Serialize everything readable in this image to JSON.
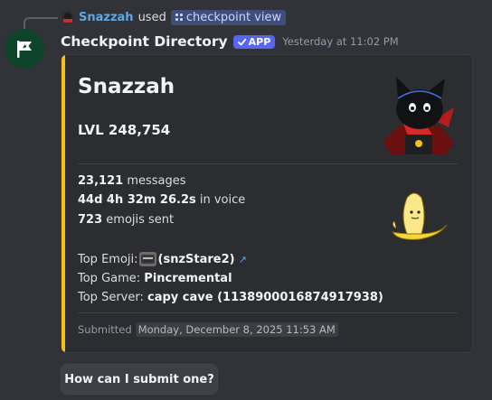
{
  "reply": {
    "username": "Snazzah",
    "verb": "used",
    "command": "checkpoint view"
  },
  "message": {
    "bot_name": "Checkpoint Directory",
    "badge": "APP",
    "timestamp": "Yesterday at 11:02 PM"
  },
  "embed": {
    "accent_color": "#f2c218",
    "title": "Snazzah",
    "level": "LVL 248,754",
    "messages": {
      "value": "23,121",
      "label": "messages"
    },
    "voice": {
      "value": "44d 4h 32m 26.2s",
      "label": "in voice"
    },
    "emojis": {
      "value": "723",
      "label": "emojis sent"
    },
    "top_emoji": {
      "label": "Top Emoji:",
      "value": "(snzStare2)",
      "icon": "snzStare2-emoji"
    },
    "top_game": {
      "label": "Top Game:",
      "value": "Pincremental"
    },
    "top_server": {
      "label": "Top Server:",
      "value": "capy cave (1138900016874917938)"
    },
    "footer_label": "Submitted",
    "footer_time": "Monday, December 8, 2025 11:53 AM"
  },
  "button": {
    "label": "How can I submit one?"
  }
}
